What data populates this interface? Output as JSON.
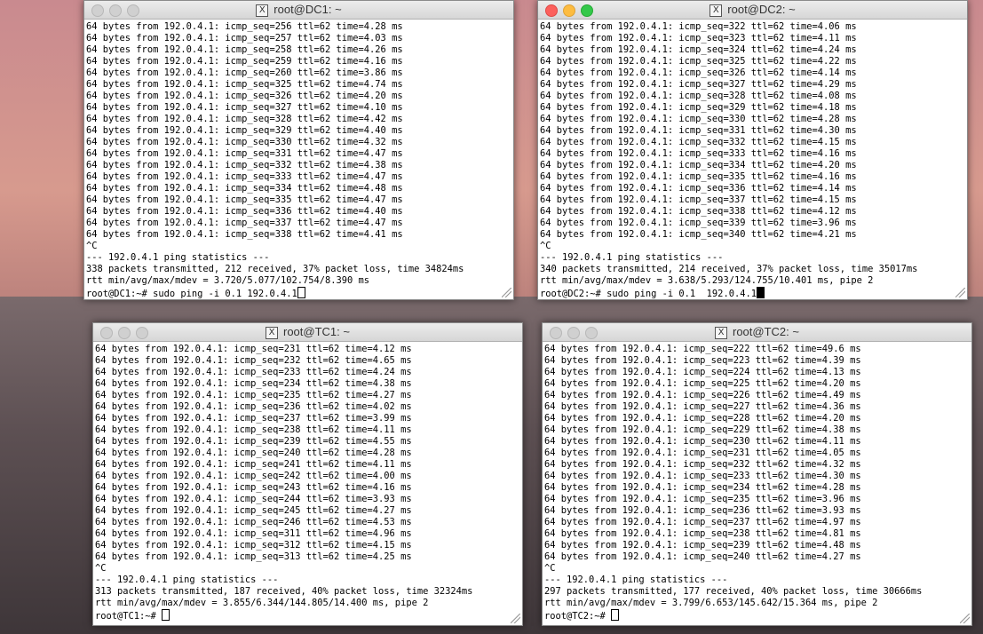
{
  "windows": {
    "dc1": {
      "title": "root@DC1: ~",
      "lines": [
        "64 bytes from 192.0.4.1: icmp_seq=256 ttl=62 time=4.28 ms",
        "64 bytes from 192.0.4.1: icmp_seq=257 ttl=62 time=4.03 ms",
        "64 bytes from 192.0.4.1: icmp_seq=258 ttl=62 time=4.26 ms",
        "64 bytes from 192.0.4.1: icmp_seq=259 ttl=62 time=4.16 ms",
        "64 bytes from 192.0.4.1: icmp_seq=260 ttl=62 time=3.86 ms",
        "64 bytes from 192.0.4.1: icmp_seq=325 ttl=62 time=4.74 ms",
        "64 bytes from 192.0.4.1: icmp_seq=326 ttl=62 time=4.20 ms",
        "64 bytes from 192.0.4.1: icmp_seq=327 ttl=62 time=4.10 ms",
        "64 bytes from 192.0.4.1: icmp_seq=328 ttl=62 time=4.42 ms",
        "64 bytes from 192.0.4.1: icmp_seq=329 ttl=62 time=4.40 ms",
        "64 bytes from 192.0.4.1: icmp_seq=330 ttl=62 time=4.32 ms",
        "64 bytes from 192.0.4.1: icmp_seq=331 ttl=62 time=4.47 ms",
        "64 bytes from 192.0.4.1: icmp_seq=332 ttl=62 time=4.38 ms",
        "64 bytes from 192.0.4.1: icmp_seq=333 ttl=62 time=4.47 ms",
        "64 bytes from 192.0.4.1: icmp_seq=334 ttl=62 time=4.48 ms",
        "64 bytes from 192.0.4.1: icmp_seq=335 ttl=62 time=4.47 ms",
        "64 bytes from 192.0.4.1: icmp_seq=336 ttl=62 time=4.40 ms",
        "64 bytes from 192.0.4.1: icmp_seq=337 ttl=62 time=4.47 ms",
        "64 bytes from 192.0.4.1: icmp_seq=338 ttl=62 time=4.41 ms",
        "^C",
        "--- 192.0.4.1 ping statistics ---",
        "338 packets transmitted, 212 received, 37% packet loss, time 34824ms",
        "rtt min/avg/max/mdev = 3.720/5.077/102.754/8.390 ms"
      ],
      "prompt": "root@DC1:~# sudo ping -i 0.1 192.0.4.1"
    },
    "dc2": {
      "title": "root@DC2: ~",
      "lines": [
        "64 bytes from 192.0.4.1: icmp_seq=322 ttl=62 time=4.06 ms",
        "64 bytes from 192.0.4.1: icmp_seq=323 ttl=62 time=4.11 ms",
        "64 bytes from 192.0.4.1: icmp_seq=324 ttl=62 time=4.24 ms",
        "64 bytes from 192.0.4.1: icmp_seq=325 ttl=62 time=4.22 ms",
        "64 bytes from 192.0.4.1: icmp_seq=326 ttl=62 time=4.14 ms",
        "64 bytes from 192.0.4.1: icmp_seq=327 ttl=62 time=4.29 ms",
        "64 bytes from 192.0.4.1: icmp_seq=328 ttl=62 time=4.08 ms",
        "64 bytes from 192.0.4.1: icmp_seq=329 ttl=62 time=4.18 ms",
        "64 bytes from 192.0.4.1: icmp_seq=330 ttl=62 time=4.28 ms",
        "64 bytes from 192.0.4.1: icmp_seq=331 ttl=62 time=4.30 ms",
        "64 bytes from 192.0.4.1: icmp_seq=332 ttl=62 time=4.15 ms",
        "64 bytes from 192.0.4.1: icmp_seq=333 ttl=62 time=4.16 ms",
        "64 bytes from 192.0.4.1: icmp_seq=334 ttl=62 time=4.20 ms",
        "64 bytes from 192.0.4.1: icmp_seq=335 ttl=62 time=4.16 ms",
        "64 bytes from 192.0.4.1: icmp_seq=336 ttl=62 time=4.14 ms",
        "64 bytes from 192.0.4.1: icmp_seq=337 ttl=62 time=4.15 ms",
        "64 bytes from 192.0.4.1: icmp_seq=338 ttl=62 time=4.12 ms",
        "64 bytes from 192.0.4.1: icmp_seq=339 ttl=62 time=3.96 ms",
        "64 bytes from 192.0.4.1: icmp_seq=340 ttl=62 time=4.21 ms",
        "^C",
        "--- 192.0.4.1 ping statistics ---",
        "340 packets transmitted, 214 received, 37% packet loss, time 35017ms",
        "rtt min/avg/max/mdev = 3.638/5.293/124.755/10.401 ms, pipe 2"
      ],
      "prompt": "root@DC2:~# sudo ping -i 0.1  192.0.4.1"
    },
    "tc1": {
      "title": "root@TC1: ~",
      "lines": [
        "64 bytes from 192.0.4.1: icmp_seq=231 ttl=62 time=4.12 ms",
        "64 bytes from 192.0.4.1: icmp_seq=232 ttl=62 time=4.65 ms",
        "64 bytes from 192.0.4.1: icmp_seq=233 ttl=62 time=4.24 ms",
        "64 bytes from 192.0.4.1: icmp_seq=234 ttl=62 time=4.38 ms",
        "64 bytes from 192.0.4.1: icmp_seq=235 ttl=62 time=4.27 ms",
        "64 bytes from 192.0.4.1: icmp_seq=236 ttl=62 time=4.02 ms",
        "64 bytes from 192.0.4.1: icmp_seq=237 ttl=62 time=3.99 ms",
        "64 bytes from 192.0.4.1: icmp_seq=238 ttl=62 time=4.11 ms",
        "64 bytes from 192.0.4.1: icmp_seq=239 ttl=62 time=4.55 ms",
        "64 bytes from 192.0.4.1: icmp_seq=240 ttl=62 time=4.28 ms",
        "64 bytes from 192.0.4.1: icmp_seq=241 ttl=62 time=4.11 ms",
        "64 bytes from 192.0.4.1: icmp_seq=242 ttl=62 time=4.00 ms",
        "64 bytes from 192.0.4.1: icmp_seq=243 ttl=62 time=4.16 ms",
        "64 bytes from 192.0.4.1: icmp_seq=244 ttl=62 time=3.93 ms",
        "64 bytes from 192.0.4.1: icmp_seq=245 ttl=62 time=4.27 ms",
        "64 bytes from 192.0.4.1: icmp_seq=246 ttl=62 time=4.53 ms",
        "64 bytes from 192.0.4.1: icmp_seq=311 ttl=62 time=4.96 ms",
        "64 bytes from 192.0.4.1: icmp_seq=312 ttl=62 time=4.15 ms",
        "64 bytes from 192.0.4.1: icmp_seq=313 ttl=62 time=4.25 ms",
        "^C",
        "--- 192.0.4.1 ping statistics ---",
        "313 packets transmitted, 187 received, 40% packet loss, time 32324ms",
        "rtt min/avg/max/mdev = 3.855/6.344/144.805/14.400 ms, pipe 2"
      ],
      "prompt": "root@TC1:~# "
    },
    "tc2": {
      "title": "root@TC2: ~",
      "lines": [
        "64 bytes from 192.0.4.1: icmp_seq=222 ttl=62 time=49.6 ms",
        "64 bytes from 192.0.4.1: icmp_seq=223 ttl=62 time=4.39 ms",
        "64 bytes from 192.0.4.1: icmp_seq=224 ttl=62 time=4.13 ms",
        "64 bytes from 192.0.4.1: icmp_seq=225 ttl=62 time=4.20 ms",
        "64 bytes from 192.0.4.1: icmp_seq=226 ttl=62 time=4.49 ms",
        "64 bytes from 192.0.4.1: icmp_seq=227 ttl=62 time=4.36 ms",
        "64 bytes from 192.0.4.1: icmp_seq=228 ttl=62 time=4.20 ms",
        "64 bytes from 192.0.4.1: icmp_seq=229 ttl=62 time=4.38 ms",
        "64 bytes from 192.0.4.1: icmp_seq=230 ttl=62 time=4.11 ms",
        "64 bytes from 192.0.4.1: icmp_seq=231 ttl=62 time=4.05 ms",
        "64 bytes from 192.0.4.1: icmp_seq=232 ttl=62 time=4.32 ms",
        "64 bytes from 192.0.4.1: icmp_seq=233 ttl=62 time=4.30 ms",
        "64 bytes from 192.0.4.1: icmp_seq=234 ttl=62 time=4.28 ms",
        "64 bytes from 192.0.4.1: icmp_seq=235 ttl=62 time=3.96 ms",
        "64 bytes from 192.0.4.1: icmp_seq=236 ttl=62 time=3.93 ms",
        "64 bytes from 192.0.4.1: icmp_seq=237 ttl=62 time=4.97 ms",
        "64 bytes from 192.0.4.1: icmp_seq=238 ttl=62 time=4.81 ms",
        "64 bytes from 192.0.4.1: icmp_seq=239 ttl=62 time=4.48 ms",
        "64 bytes from 192.0.4.1: icmp_seq=240 ttl=62 time=4.27 ms",
        "^C",
        "--- 192.0.4.1 ping statistics ---",
        "297 packets transmitted, 177 received, 40% packet loss, time 30666ms",
        "rtt min/avg/max/mdev = 3.799/6.653/145.642/15.364 ms, pipe 2"
      ],
      "prompt": "root@TC2:~# "
    }
  },
  "icons": {
    "x11": "X"
  }
}
